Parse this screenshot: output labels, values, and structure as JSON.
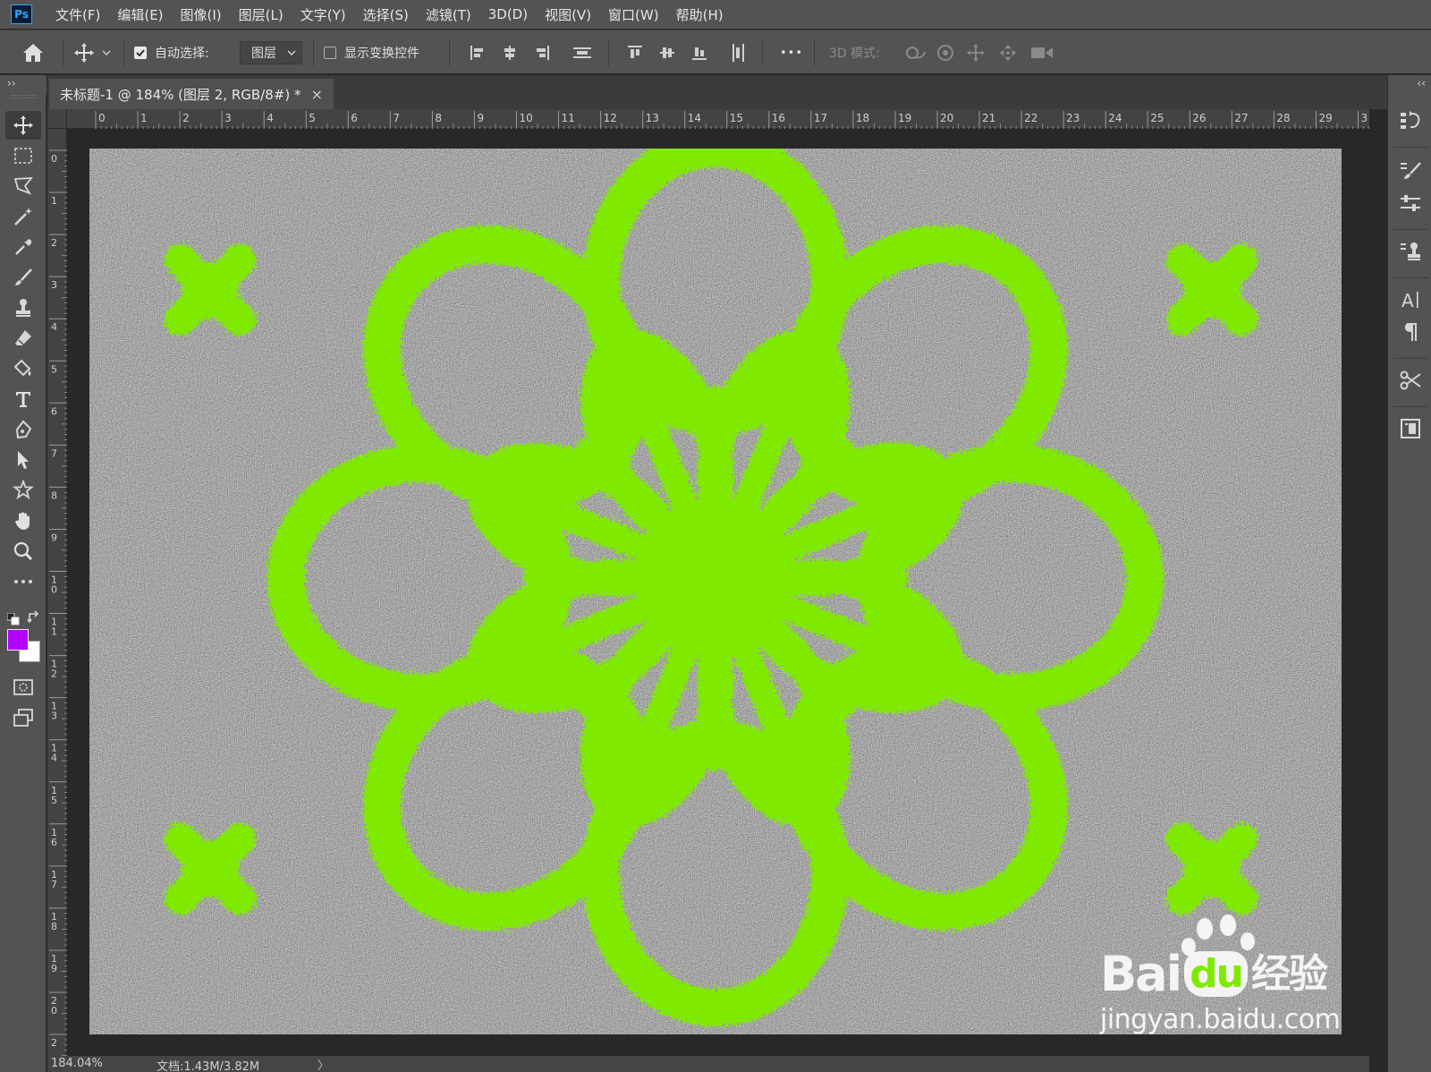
{
  "app": {
    "logo_text": "Ps"
  },
  "menu": {
    "items": [
      {
        "id": "file",
        "label": "文件(F)"
      },
      {
        "id": "edit",
        "label": "编辑(E)"
      },
      {
        "id": "image",
        "label": "图像(I)"
      },
      {
        "id": "layer",
        "label": "图层(L)"
      },
      {
        "id": "type",
        "label": "文字(Y)"
      },
      {
        "id": "select",
        "label": "选择(S)"
      },
      {
        "id": "filter",
        "label": "滤镜(T)"
      },
      {
        "id": "3d",
        "label": "3D(D)"
      },
      {
        "id": "view",
        "label": "视图(V)"
      },
      {
        "id": "window",
        "label": "窗口(W)"
      },
      {
        "id": "help",
        "label": "帮助(H)"
      }
    ]
  },
  "options": {
    "auto_select_label": "自动选择:",
    "auto_select_checked": true,
    "auto_select_target": "图层",
    "show_transform_label": "显示变换控件",
    "show_transform_checked": false,
    "more_label": "•••",
    "mode_3d_label": "3D 模式:"
  },
  "document": {
    "tab_title": "未标题-1 @ 184% (图层 2, RGB/8#) *",
    "close_glyph": "×",
    "zoom_status": "184.04%",
    "doc_size": "文档:1.43M/3.82M",
    "status_arrow": "〉"
  },
  "rulers": {
    "horizontal_ticks": [
      "0",
      "1",
      "2",
      "3",
      "4",
      "5",
      "6",
      "7",
      "8",
      "9",
      "10",
      "11",
      "12",
      "13",
      "14",
      "15",
      "16",
      "17",
      "18",
      "19",
      "20",
      "21",
      "22",
      "23",
      "24",
      "25",
      "26",
      "27",
      "28",
      "29",
      "3"
    ],
    "vertical_ticks": [
      "0",
      "1",
      "2",
      "3",
      "4",
      "5",
      "6",
      "7",
      "8",
      "9",
      "1 0",
      "1 1",
      "1 2",
      "1 3",
      "1 4",
      "1 5",
      "1 6",
      "1 7",
      "1 8",
      "1 9",
      "2 0",
      "2"
    ]
  },
  "colors": {
    "foreground": "#b300ff",
    "background": "#ffffff",
    "canvas_pattern": "#8a8a8a",
    "shape_fill": "#7fea00",
    "ui_panel": "#535353"
  },
  "tools": [
    {
      "id": "move",
      "icon": "move-icon",
      "active": true
    },
    {
      "id": "marquee",
      "icon": "rect-marquee-icon"
    },
    {
      "id": "lasso",
      "icon": "polygon-lasso-icon"
    },
    {
      "id": "magic-wand",
      "icon": "magic-wand-icon"
    },
    {
      "id": "eyedropper",
      "icon": "eyedropper-icon"
    },
    {
      "id": "brush",
      "icon": "brush-icon"
    },
    {
      "id": "stamp",
      "icon": "clone-stamp-icon"
    },
    {
      "id": "eraser",
      "icon": "eraser-icon"
    },
    {
      "id": "paint-bucket",
      "icon": "paint-bucket-icon"
    },
    {
      "id": "type",
      "icon": "type-icon"
    },
    {
      "id": "pen",
      "icon": "pen-icon"
    },
    {
      "id": "path-select",
      "icon": "path-select-icon"
    },
    {
      "id": "custom-shape",
      "icon": "custom-shape-icon"
    },
    {
      "id": "hand",
      "icon": "hand-icon"
    },
    {
      "id": "zoom",
      "icon": "zoom-icon"
    },
    {
      "id": "more",
      "icon": "more-tools-icon"
    }
  ],
  "watermark": {
    "brand_latin": "Bai",
    "brand_du": "du",
    "brand_cn": "经验",
    "url": "jingyan.baidu.com"
  }
}
